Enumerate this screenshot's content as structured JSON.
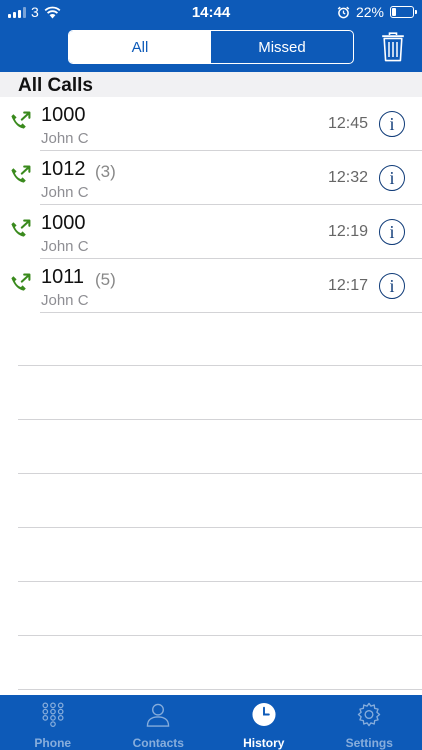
{
  "status_bar": {
    "carrier": "3",
    "time": "14:44",
    "battery_percent": "22%",
    "battery_level": 0.22,
    "icons": [
      "signal-icon",
      "wifi-icon",
      "alarm-icon",
      "battery-icon"
    ]
  },
  "filter": {
    "all_label": "All",
    "missed_label": "Missed",
    "selected": "All"
  },
  "section_title": "All Calls",
  "calls": [
    {
      "number": "1000",
      "count": "",
      "name": "John C",
      "time": "12:45",
      "direction": "outgoing"
    },
    {
      "number": "1012",
      "count": "(3)",
      "name": "John C",
      "time": "12:32",
      "direction": "outgoing"
    },
    {
      "number": "1000",
      "count": "",
      "name": "John C",
      "time": "12:19",
      "direction": "outgoing"
    },
    {
      "number": "1011",
      "count": "(5)",
      "name": "John C",
      "time": "12:17",
      "direction": "outgoing"
    }
  ],
  "info_glyph": "i",
  "tabs": [
    {
      "label": "Phone",
      "icon": "keypad-icon"
    },
    {
      "label": "Contacts",
      "icon": "person-icon"
    },
    {
      "label": "History",
      "icon": "clock-icon"
    },
    {
      "label": "Settings",
      "icon": "gear-icon"
    }
  ],
  "active_tab": "History",
  "colors": {
    "brand_blue": "#0d5ab8",
    "call_green": "#3a8a1d",
    "info_navy": "#0f3b78"
  }
}
